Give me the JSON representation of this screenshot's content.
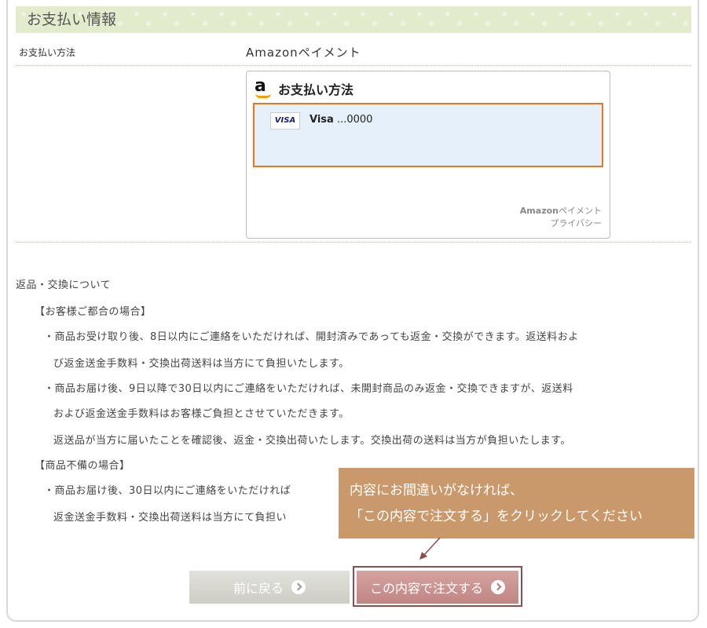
{
  "section": {
    "title": "お支払い情報"
  },
  "payment_row": {
    "label": "お支払い方法",
    "value": "Amazonペイメント"
  },
  "widget": {
    "title": "お支払い方法",
    "card_logo": "VISA",
    "card_brand": "Visa",
    "card_number": " ...0000",
    "footer_brand": "Amazon",
    "footer_brand_suffix": "ペイメント",
    "footer_privacy": "プライバシー"
  },
  "policy": {
    "lines": [
      "返品・交換について",
      "【お客様ご都合の場合】",
      "・商品お受け取り後、8日以内にご連絡をいただければ、開封済みであっても返金・交換ができます。返送料およ",
      "び返金送金手数料・交換出荷送料は当方にて負担いたします。",
      "・商品お届け後、9日以降で30日以内にご連絡をいただければ、未開封商品のみ返金・交換できますが、返送料",
      "および返金送金手数料はお客様ご負担とさせていただきます。",
      "返送品が当方に届いたことを確認後、返金・交換出荷いたします。交換出荷の送料は当方が負担いたします。",
      "【商品不備の場合】",
      "・商品お届け後、30日以内にご連絡をいただければ",
      "返金送金手数料・交換出荷送料は当方にて負担い"
    ]
  },
  "tooltip": {
    "line1": "内容にお間違いがなければ、",
    "line2": "「この内容で注文する」をクリックしてください"
  },
  "buttons": {
    "back_label": "前に戻る",
    "order_label": "この内容で注文する"
  },
  "colors": {
    "header_bg": "#e2eccd",
    "card_border": "#e7761c",
    "tooltip_bg": "#c9996b",
    "order_button": "#c78d8b",
    "back_button": "#d6d6cf"
  },
  "icons": {
    "amazon_logo": "amazon-logo-icon",
    "visa": "visa-card-icon",
    "arrow": "circle-arrow-right-icon",
    "pointer": "pointer-arrow-icon"
  }
}
